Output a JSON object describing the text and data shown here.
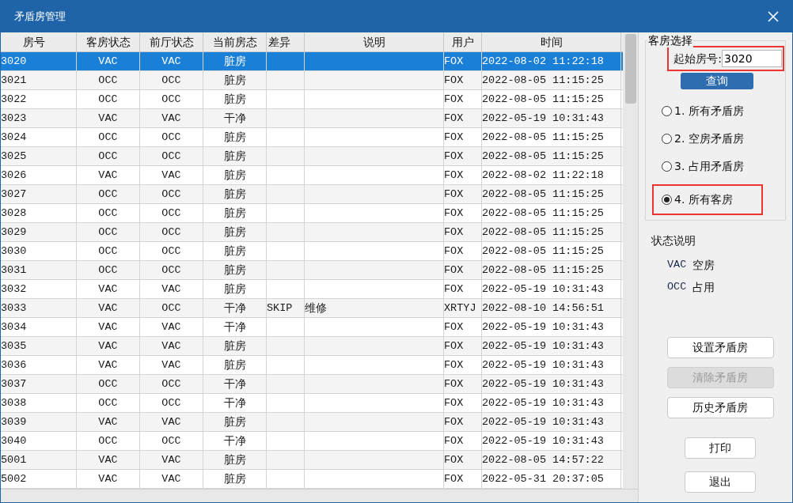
{
  "window": {
    "title": "矛盾房管理"
  },
  "table": {
    "columns": [
      "房号",
      "客房状态",
      "前厅状态",
      "当前房态",
      "差异",
      "说明",
      "用户",
      "时间"
    ],
    "rows": [
      {
        "selected": true,
        "cells": [
          "3020",
          "VAC",
          "VAC",
          "脏房",
          "",
          "",
          "FOX",
          "2022-08-02 11:22:18"
        ]
      },
      {
        "selected": false,
        "cells": [
          "3021",
          "OCC",
          "OCC",
          "脏房",
          "",
          "",
          "FOX",
          "2022-08-05 11:15:25"
        ]
      },
      {
        "selected": false,
        "cells": [
          "3022",
          "OCC",
          "OCC",
          "脏房",
          "",
          "",
          "FOX",
          "2022-08-05 11:15:25"
        ]
      },
      {
        "selected": false,
        "cells": [
          "3023",
          "VAC",
          "VAC",
          "干净",
          "",
          "",
          "FOX",
          "2022-05-19 10:31:43"
        ]
      },
      {
        "selected": false,
        "cells": [
          "3024",
          "OCC",
          "OCC",
          "脏房",
          "",
          "",
          "FOX",
          "2022-08-05 11:15:25"
        ]
      },
      {
        "selected": false,
        "cells": [
          "3025",
          "OCC",
          "OCC",
          "脏房",
          "",
          "",
          "FOX",
          "2022-08-05 11:15:25"
        ]
      },
      {
        "selected": false,
        "cells": [
          "3026",
          "VAC",
          "VAC",
          "脏房",
          "",
          "",
          "FOX",
          "2022-08-02 11:22:18"
        ]
      },
      {
        "selected": false,
        "cells": [
          "3027",
          "OCC",
          "OCC",
          "脏房",
          "",
          "",
          "FOX",
          "2022-08-05 11:15:25"
        ]
      },
      {
        "selected": false,
        "cells": [
          "3028",
          "OCC",
          "OCC",
          "脏房",
          "",
          "",
          "FOX",
          "2022-08-05 11:15:25"
        ]
      },
      {
        "selected": false,
        "cells": [
          "3029",
          "OCC",
          "OCC",
          "脏房",
          "",
          "",
          "FOX",
          "2022-08-05 11:15:25"
        ]
      },
      {
        "selected": false,
        "cells": [
          "3030",
          "OCC",
          "OCC",
          "脏房",
          "",
          "",
          "FOX",
          "2022-08-05 11:15:25"
        ]
      },
      {
        "selected": false,
        "cells": [
          "3031",
          "OCC",
          "OCC",
          "脏房",
          "",
          "",
          "FOX",
          "2022-08-05 11:15:25"
        ]
      },
      {
        "selected": false,
        "cells": [
          "3032",
          "VAC",
          "VAC",
          "脏房",
          "",
          "",
          "FOX",
          "2022-05-19 10:31:43"
        ]
      },
      {
        "selected": false,
        "cells": [
          "3033",
          "VAC",
          "OCC",
          "干净",
          "SKIP",
          "维修",
          "XRTYJ",
          "2022-08-10 14:56:51"
        ]
      },
      {
        "selected": false,
        "cells": [
          "3034",
          "VAC",
          "VAC",
          "干净",
          "",
          "",
          "FOX",
          "2022-05-19 10:31:43"
        ]
      },
      {
        "selected": false,
        "cells": [
          "3035",
          "VAC",
          "VAC",
          "脏房",
          "",
          "",
          "FOX",
          "2022-05-19 10:31:43"
        ]
      },
      {
        "selected": false,
        "cells": [
          "3036",
          "VAC",
          "VAC",
          "脏房",
          "",
          "",
          "FOX",
          "2022-05-19 10:31:43"
        ]
      },
      {
        "selected": false,
        "cells": [
          "3037",
          "OCC",
          "OCC",
          "干净",
          "",
          "",
          "FOX",
          "2022-05-19 10:31:43"
        ]
      },
      {
        "selected": false,
        "cells": [
          "3038",
          "OCC",
          "OCC",
          "干净",
          "",
          "",
          "FOX",
          "2022-05-19 10:31:43"
        ]
      },
      {
        "selected": false,
        "cells": [
          "3039",
          "VAC",
          "VAC",
          "脏房",
          "",
          "",
          "FOX",
          "2022-05-19 10:31:43"
        ]
      },
      {
        "selected": false,
        "cells": [
          "3040",
          "OCC",
          "OCC",
          "干净",
          "",
          "",
          "FOX",
          "2022-05-19 10:31:43"
        ]
      },
      {
        "selected": false,
        "cells": [
          "5001",
          "VAC",
          "VAC",
          "脏房",
          "",
          "",
          "FOX",
          "2022-08-05 14:57:22"
        ]
      },
      {
        "selected": false,
        "cells": [
          "5002",
          "VAC",
          "VAC",
          "脏房",
          "",
          "",
          "FOX",
          "2022-05-31 20:37:05"
        ]
      }
    ]
  },
  "room_selection": {
    "title": "客房选择",
    "start_label": "起始房号:",
    "start_value": "3020",
    "start_highlighted": true,
    "query_button": "查询",
    "options": [
      {
        "label": "1. 所有矛盾房",
        "selected": false,
        "highlighted": false
      },
      {
        "label": "2. 空房矛盾房",
        "selected": false,
        "highlighted": false
      },
      {
        "label": "3. 占用矛盾房",
        "selected": false,
        "highlighted": false
      },
      {
        "label": "4. 所有客房",
        "selected": true,
        "highlighted": true
      }
    ]
  },
  "legend": {
    "title": "状态说明",
    "items": [
      {
        "code": "VAC",
        "meaning": "空房"
      },
      {
        "code": "OCC",
        "meaning": "占用"
      }
    ]
  },
  "actions": [
    {
      "label": "设置矛盾房",
      "disabled": false
    },
    {
      "label": "清除矛盾房",
      "disabled": true
    },
    {
      "label": "历史矛盾房",
      "disabled": false
    }
  ],
  "buttons": [
    "打印",
    "退出"
  ]
}
